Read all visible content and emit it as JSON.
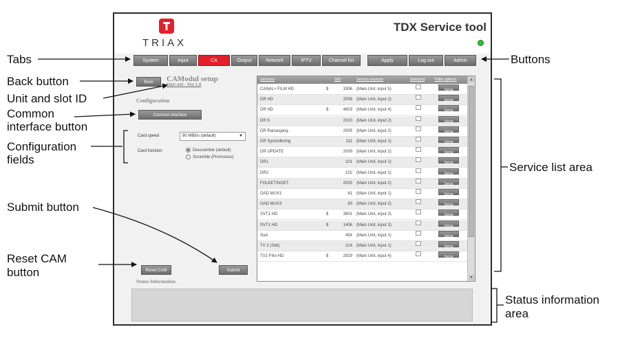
{
  "app": {
    "logo_text": "TRIAX",
    "title": "TDX Service tool",
    "tabs": [
      "System",
      "Input",
      "CA Modules",
      "Output",
      "Network",
      "IPTV",
      "Channel list"
    ],
    "active_tab": "CA Modules",
    "buttons": [
      "Apply",
      "Log out",
      "Admin"
    ],
    "status_color": "#2ec22e",
    "accent_color": "#e2202b"
  },
  "left": {
    "back_label": "Back",
    "page_title": "CAModul setup",
    "unit_slot": "Main unit - Slot 1-8",
    "config_heading": "Configuration",
    "ci_button": "Common interface",
    "card_speed_label": "Card speed",
    "card_speed_value": "90 MBit/s (default)",
    "card_function_label": "Card function",
    "radio_descramble": "Descramble (default)",
    "radio_scramble": "Scramble (ProAccess)",
    "reset_label": "Reset CAM",
    "submit_label": "Submit",
    "status_heading": "Status Information"
  },
  "services": {
    "columns": [
      "Services",
      "SID",
      "Service sources",
      "Selected",
      "Filter options"
    ],
    "setup_label": "Setup",
    "rows": [
      {
        "name": "CANAL+ FILM HD",
        "sym": "$",
        "sid": "3306",
        "source": "(Main Unit, input 5)"
      },
      {
        "name": "DR HD",
        "sym": "",
        "sid": "2008",
        "source": "(Main Unit, input 2)"
      },
      {
        "name": "DR HD",
        "sym": "$",
        "sid": "4803",
        "source": "(Main Unit, input 4)"
      },
      {
        "name": "DR K",
        "sym": "",
        "sid": "2010",
        "source": "(Main Unit, input 2)"
      },
      {
        "name": "DR Ramasjang",
        "sym": "",
        "sid": "2005",
        "source": "(Main Unit, input 2)"
      },
      {
        "name": "DR Synstolkning",
        "sym": "",
        "sid": "111",
        "source": "(Main Unit, input 1)"
      },
      {
        "name": "DR UPDATE",
        "sym": "",
        "sid": "2009",
        "source": "(Main Unit, input 2)"
      },
      {
        "name": "DR1",
        "sym": "",
        "sid": "101",
        "source": "(Main Unit, input 1)"
      },
      {
        "name": "DR2",
        "sym": "",
        "sid": "102",
        "source": "(Main Unit, input 1)"
      },
      {
        "name": "FOLKETINGET",
        "sym": "",
        "sid": "2003",
        "source": "(Main Unit, input 2)"
      },
      {
        "name": "OAD MUX1",
        "sym": "",
        "sid": "81",
        "source": "(Main Unit, input 1)"
      },
      {
        "name": "OAD MUX3",
        "sym": "",
        "sid": "83",
        "source": "(Main Unit, input 2)"
      },
      {
        "name": "SVT1 HD",
        "sym": "$",
        "sid": "3801",
        "source": "(Main Unit, input 3)"
      },
      {
        "name": "SVT1 HD",
        "sym": "$",
        "sid": "1406",
        "source": "(Main Unit, input 3)"
      },
      {
        "name": "Sud",
        "sym": "",
        "sid": "454",
        "source": "(Main Unit, input 1)"
      },
      {
        "name": "TV 2 (Sild)",
        "sym": "",
        "sid": "214",
        "source": "(Main Unit, input 1)"
      },
      {
        "name": "TV2 Film HD",
        "sym": "$",
        "sid": "2929",
        "source": "(Main Unit, input 4)"
      }
    ]
  },
  "callouts": {
    "tabs": "Tabs",
    "back": "Back button",
    "unit": "Unit and slot ID",
    "common1": "Common",
    "common2": "interface button",
    "config1": "Configuration",
    "config2": "fields",
    "submit": "Submit button",
    "reset1": "Reset CAM",
    "reset2": "button",
    "buttons": "Buttons",
    "service": "Service list area",
    "status1": "Status information",
    "status2": "area"
  }
}
